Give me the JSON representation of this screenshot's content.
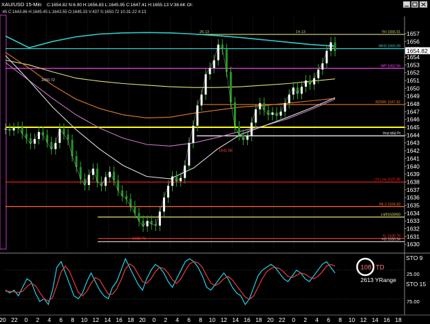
{
  "header": {
    "symbol_text": "XAU/USD 15-Min",
    "ohlc_text": "C:1654.82  N:6.90  H:1656.83  L:1645.95  C:1647.41  H:1655.13  V:38.6K  OI:",
    "sub_text": ":45  C:1643.86  H:1645.45  L:1643.55  O:1645.33  V:437  S:1650.72  10-31-22  4:13"
  },
  "window_buttons": {
    "minimize": "minimize",
    "maximize": "maximize",
    "close": "close"
  },
  "chart_data": [
    {
      "type": "line",
      "title": "XAU/USD 15-Min",
      "ylim": [
        1629.4,
        1659.2
      ],
      "y_ticks": [
        1630,
        1631,
        1632,
        1633,
        1634,
        1635,
        1636,
        1637,
        1638,
        1639,
        1640,
        1641,
        1642,
        1643,
        1644,
        1645,
        1646,
        1647,
        1648,
        1649,
        1650,
        1651,
        1652,
        1653,
        1654,
        1655,
        1656,
        1657
      ],
      "current_price": "1654.82",
      "x_tick_labels": [
        "20",
        "22",
        "0",
        "2",
        "4",
        "6",
        "8",
        "10",
        "12",
        "14",
        "16",
        "18",
        "20",
        "0",
        "2",
        "4",
        "6",
        "8",
        "10",
        "12",
        "14",
        "16",
        "18",
        "20",
        "22",
        "0",
        "2",
        "4",
        "6",
        "8",
        "10",
        "12",
        "14",
        "16",
        "18"
      ],
      "price_series": [
        {
          "name": "close",
          "color": "#ffffff",
          "values": [
            1644.8,
            1644.6,
            1644.9,
            1645.0,
            1644.2,
            1643.6,
            1642.9,
            1643.5,
            1644.4,
            1644.0,
            1643.1,
            1642.2,
            1643.0,
            1644.8,
            1644.1,
            1643.4,
            1641.3,
            1639.9,
            1638.4,
            1637.6,
            1638.9,
            1639.7,
            1638.0,
            1637.5,
            1638.6,
            1639.3,
            1638.2,
            1636.9,
            1636.2,
            1635.8,
            1634.9,
            1634.0,
            1633.0,
            1632.3,
            1633.0,
            1632.6,
            1632.4,
            1634.2,
            1636.0,
            1637.5,
            1638.7,
            1638.1,
            1638.5,
            1640.1,
            1643.0,
            1645.2,
            1647.8,
            1649.2,
            1651.8,
            1652.6,
            1653.6,
            1655.6,
            1655.0,
            1652.1,
            1648.2,
            1645.1,
            1644.0,
            1643.4,
            1643.9,
            1645.6,
            1647.3,
            1648.1,
            1647.2,
            1646.6,
            1646.9,
            1646.5,
            1647.0,
            1648.1,
            1649.2,
            1650.1,
            1649.3,
            1650.2,
            1651.0,
            1650.5,
            1651.3,
            1652.4,
            1653.2,
            1654.8,
            1655.9,
            1654.8
          ]
        },
        {
          "name": "ma-cyan",
          "color": "#33cccc",
          "values": [
            1656.7,
            1655.2,
            1656.0,
            1656.6,
            1656.95,
            1657.1,
            1657.15,
            1657.1,
            1656.95,
            1656.75,
            1656.5,
            1656.2,
            1655.9,
            1655.6,
            1655.4
          ]
        },
        {
          "name": "ma-yellow",
          "color": "#e5e07a",
          "values": [
            1653.6,
            1653.0,
            1652.1,
            1651.3,
            1650.9,
            1650.6,
            1650.4,
            1650.2,
            1650.1,
            1650.1,
            1650.2,
            1650.4,
            1650.6,
            1650.9,
            1651.2
          ]
        },
        {
          "name": "ma-orange",
          "color": "#e07b2a",
          "values": [
            1654.6,
            1652.6,
            1650.4,
            1648.6,
            1647.4,
            1646.6,
            1646.2,
            1646.3,
            1646.8,
            1647.2,
            1647.6,
            1647.8,
            1648.1,
            1648.4,
            1648.7
          ]
        },
        {
          "name": "ma-pink",
          "color": "#c878c8",
          "values": [
            1653.3,
            1651.0,
            1648.7,
            1646.6,
            1644.9,
            1643.6,
            1642.8,
            1642.6,
            1643.0,
            1643.7,
            1644.5,
            1645.2,
            1646.1,
            1647.3,
            1648.6
          ]
        },
        {
          "name": "ma-thin",
          "color": "#dddddd",
          "values": [
            1654.2,
            1651.0,
            1647.6,
            1644.7,
            1642.2,
            1640.1,
            1638.7,
            1638.4,
            1639.8,
            1642.2,
            1644.1,
            1645.2,
            1646.3,
            1647.5,
            1648.8
          ]
        }
      ],
      "levels": [
        {
          "price": 1656.91,
          "label": "YH 1656.91",
          "color": "#c8c87a",
          "start": 0.58
        },
        {
          "price": 1655.09,
          "label": "WH3 1655.09",
          "color": "#33cccc",
          "start": 0.0
        },
        {
          "price": 1652.56,
          "label": "WP 1652.56",
          "color": "#ff44ff",
          "start": 0.0
        },
        {
          "price": 1647.92,
          "label": "RDWR 1647.92",
          "color": "#e07b2a",
          "start": 0.6
        },
        {
          "price": 1645.0,
          "label": "",
          "color": "#ffff00",
          "start": 0.0
        },
        {
          "price": 1643.9,
          "label": "Yest Mid Pt",
          "color": "#ffffff",
          "start": 0.58
        },
        {
          "price": 1637.98,
          "label": "LN Low 1637.98",
          "color": "#ff2222",
          "start": 0.0
        },
        {
          "price": 1634.83,
          "label": "WL3 1634.83",
          "color": "#ff6633",
          "start": 0.0
        },
        {
          "price": 1633.5,
          "label": "L4/l/1633/50",
          "color": "#e5e07a",
          "start": 0.28
        },
        {
          "price": 1630.76,
          "label": "YL 1630.76",
          "color": "#ff3333",
          "start": 0.28
        },
        {
          "price": 1630.34,
          "label": "H3 1630.34",
          "color": "#cccccc",
          "start": 0.28
        }
      ],
      "annotations": [
        {
          "text": "1650.72",
          "price": 1650.72,
          "color": "#dddddd"
        },
        {
          "text": "26.13",
          "price": 1656.9,
          "color": "#c8c87a"
        },
        {
          "text": "14.13",
          "price": 1656.9,
          "color": "#c8c87a"
        },
        {
          "text": "1641.88",
          "price": 1641.7,
          "color": "#ff4444"
        },
        {
          "text": "1630.76",
          "price": 1630.4,
          "color": "#ff4444"
        }
      ]
    },
    {
      "type": "line",
      "title": "STO",
      "ylim": [
        0,
        100
      ],
      "y_tick_labels": [
        "25.00",
        "75.00"
      ],
      "top_labels": [
        "STO 9",
        "STO 15"
      ],
      "td_number": "108",
      "td_label": "TD",
      "yrange_text": "2613 YRange",
      "series": [
        {
          "name": "%K",
          "color": "#22d3ee",
          "values": [
            40,
            35,
            40,
            30,
            45,
            60,
            55,
            35,
            20,
            25,
            15,
            40,
            80,
            90,
            70,
            50,
            30,
            25,
            35,
            55,
            70,
            55,
            40,
            30,
            25,
            45,
            55,
            75,
            95,
            80,
            65,
            50,
            40,
            60,
            75,
            85,
            80,
            70,
            55,
            45,
            60,
            75,
            90,
            95,
            90,
            80,
            65,
            45,
            40,
            50,
            60,
            70,
            60,
            45,
            35,
            30,
            15,
            25,
            45,
            65,
            75,
            80,
            85,
            80,
            70,
            60,
            55,
            65,
            75,
            70,
            60,
            55,
            65,
            75,
            85,
            90,
            80,
            70
          ]
        },
        {
          "name": "%D",
          "color": "#ef3b3b",
          "values": [
            38,
            38,
            37,
            36,
            38,
            46,
            52,
            48,
            36,
            25,
            21,
            27,
            48,
            72,
            82,
            72,
            54,
            36,
            30,
            38,
            52,
            62,
            58,
            45,
            33,
            33,
            42,
            58,
            77,
            86,
            81,
            68,
            55,
            52,
            60,
            72,
            80,
            78,
            70,
            58,
            52,
            60,
            74,
            86,
            90,
            88,
            80,
            65,
            52,
            48,
            52,
            60,
            64,
            58,
            48,
            38,
            28,
            24,
            30,
            45,
            60,
            72,
            78,
            80,
            78,
            72,
            64,
            62,
            66,
            70,
            68,
            63,
            60,
            64,
            72,
            82,
            85,
            82
          ]
        }
      ]
    }
  ]
}
